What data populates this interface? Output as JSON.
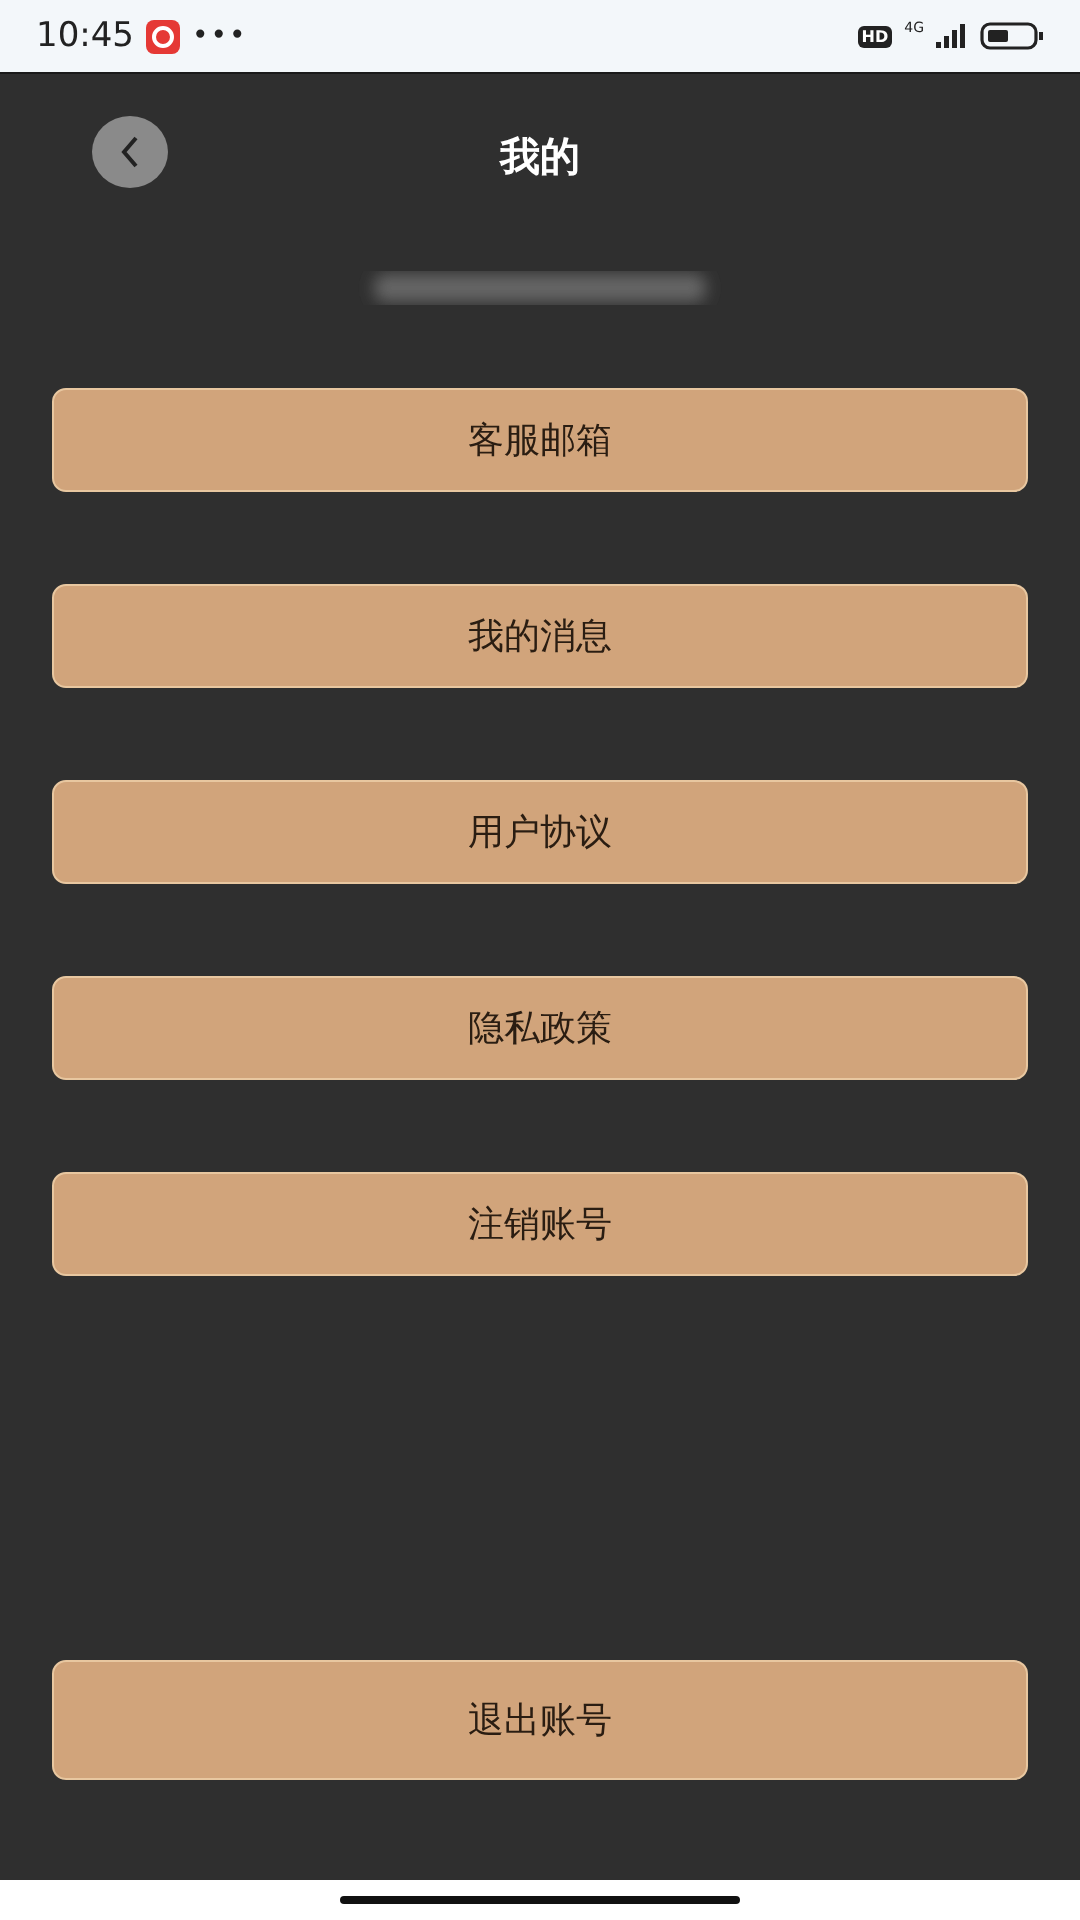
{
  "status_bar": {
    "time": "10:45",
    "more": "•••",
    "hd": "HD",
    "network": "4G"
  },
  "header": {
    "title": "我的"
  },
  "menu": [
    {
      "label": "客服邮箱"
    },
    {
      "label": "我的消息"
    },
    {
      "label": "用户协议"
    },
    {
      "label": "隐私政策"
    },
    {
      "label": "注销账号"
    }
  ],
  "logout": {
    "label": "退出账号"
  }
}
